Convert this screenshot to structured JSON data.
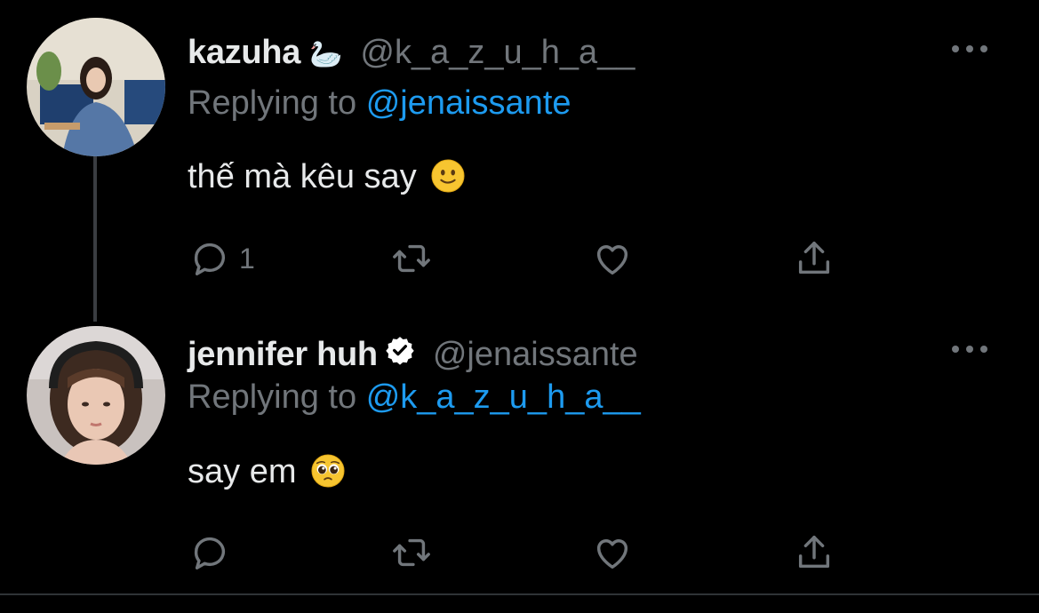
{
  "tweets": [
    {
      "name": "kazuha",
      "name_emoji": "🦢",
      "handle": "@k_a_z_u_h_a__",
      "replying_prefix": "Replying to",
      "replying_to": "@jenaissante",
      "text": "thế mà kêu say",
      "text_emoji": "slightly-smiling-face",
      "reply_count": "1",
      "verified": false
    },
    {
      "name": "jennifer huh",
      "handle": "@jenaissante",
      "replying_prefix": "Replying to",
      "replying_to": "@k_a_z_u_h_a__",
      "text": "say em",
      "text_emoji": "pleading-face",
      "reply_count": "",
      "verified": true
    }
  ],
  "colors": {
    "background": "#000000",
    "text": "#e7e9ea",
    "muted": "#71767b",
    "link": "#1d9bf0",
    "thread_line": "#3a3d41"
  },
  "icons": [
    "reply-icon",
    "retweet-icon",
    "like-icon",
    "share-icon",
    "more-icon",
    "verified-badge-icon"
  ]
}
